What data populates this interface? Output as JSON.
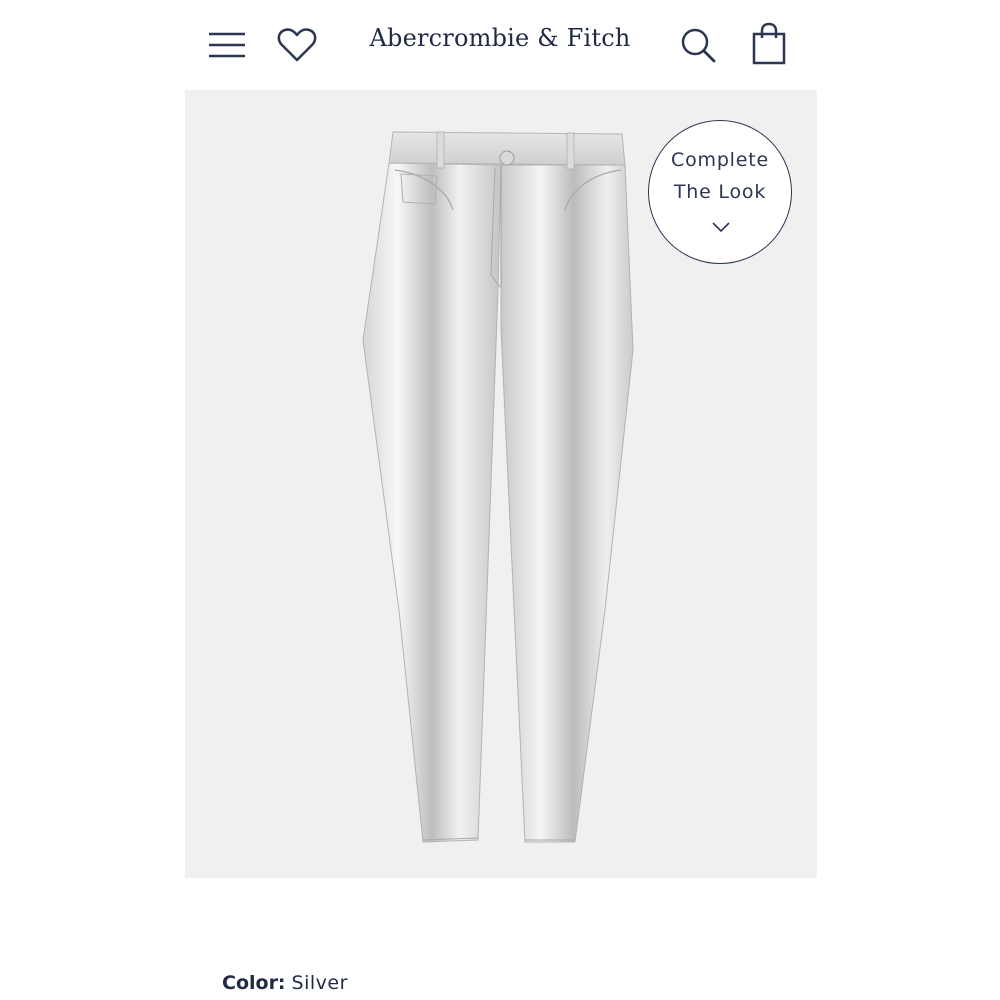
{
  "header": {
    "brand": "Abercrombie & Fitch",
    "icons": {
      "menu": "hamburger-menu-icon",
      "wishlist": "heart-icon",
      "search": "search-icon",
      "bag": "shopping-bag-icon"
    }
  },
  "product": {
    "image_alt": "Silver metallic straight-leg pants",
    "complete_the_look": {
      "line1": "Complete",
      "line2": "The Look",
      "icon": "chevron-down-icon"
    }
  },
  "details": {
    "color_label": "Color:",
    "color_value": "Silver"
  },
  "colors": {
    "brand_navy": "#1f2a44",
    "image_background": "#f0f0f0",
    "silver": "#c9c9c9"
  }
}
